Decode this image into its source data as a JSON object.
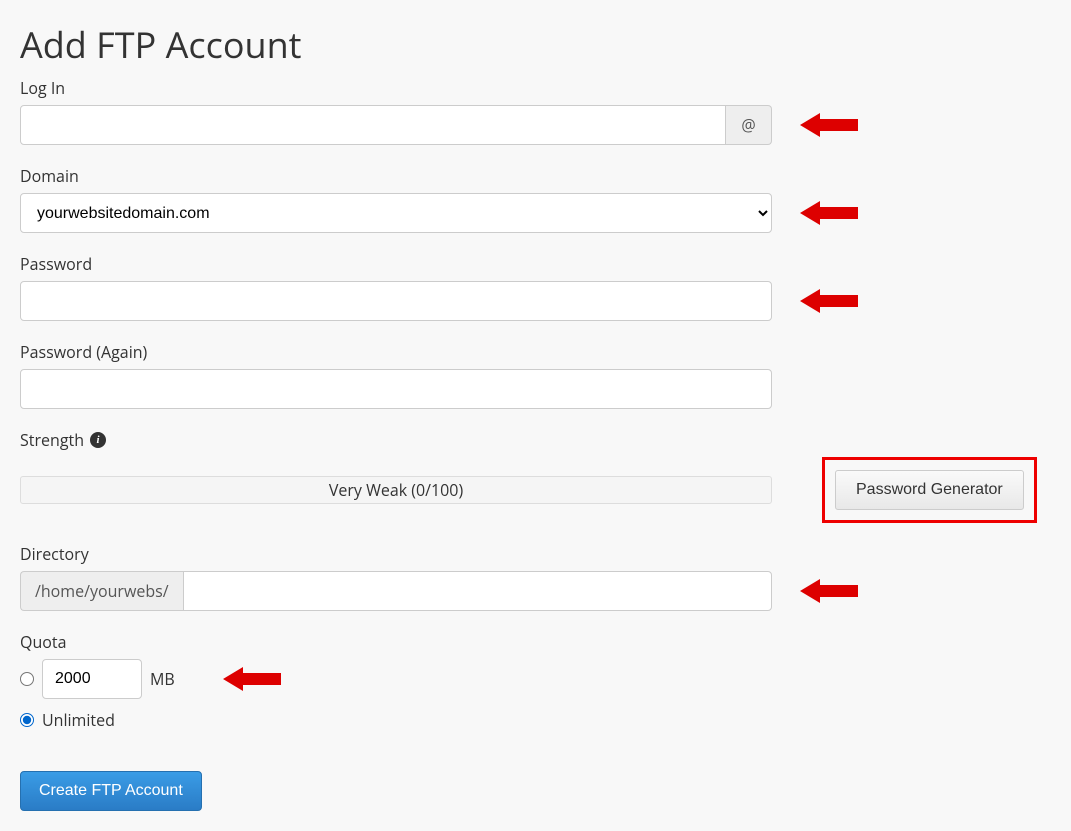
{
  "page_title": "Add FTP Account",
  "login": {
    "label": "Log In",
    "value": "",
    "addon": "@"
  },
  "domain": {
    "label": "Domain",
    "selected": "yourwebsitedomain.com"
  },
  "password": {
    "label": "Password",
    "value": ""
  },
  "password_again": {
    "label": "Password (Again)",
    "value": ""
  },
  "strength": {
    "label": "Strength",
    "meter_text": "Very Weak (0/100)",
    "generator_button": "Password Generator"
  },
  "directory": {
    "label": "Directory",
    "prefix": "/home/yourwebs/",
    "value": ""
  },
  "quota": {
    "label": "Quota",
    "value": "2000",
    "unit": "MB",
    "unlimited_label": "Unlimited"
  },
  "submit_button": "Create FTP Account"
}
